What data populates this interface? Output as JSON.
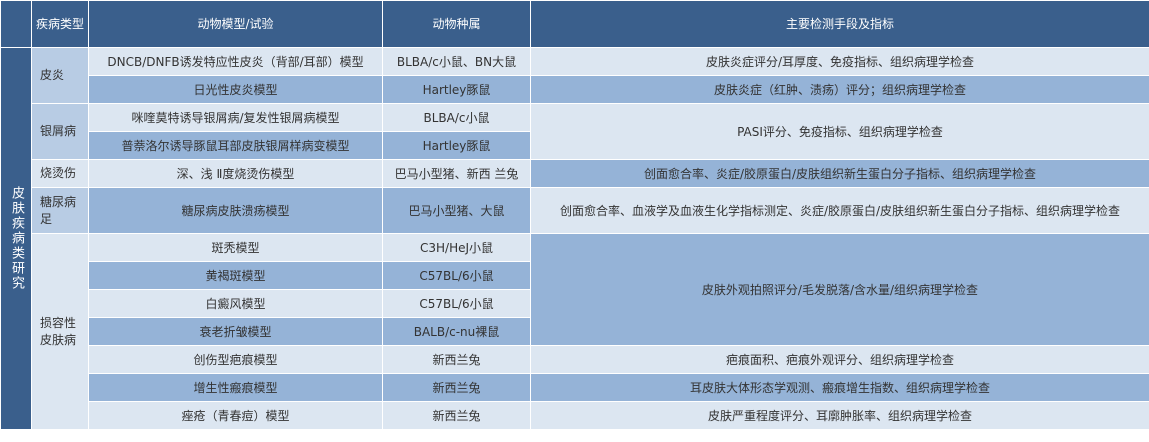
{
  "header": {
    "col_disease": "疾病类型",
    "col_model": "动物模型/试验",
    "col_species": "动物种属",
    "col_method": "主要检测手段及指标"
  },
  "side_label": "皮肤疾病类研究",
  "groups": {
    "dermatitis": "皮炎",
    "psoriasis": "银屑病",
    "burn": "烧烫伤",
    "diabetic_foot": "糖尿病足",
    "cosmetic": "损容性皮肤病"
  },
  "rows": [
    {
      "model": "DNCB/DNFB诱发特应性皮炎（背部/耳部）模型",
      "species": "BLBA/c小鼠、BN大鼠",
      "method": "皮肤炎症评分/耳厚度、免疫指标、组织病理学检查"
    },
    {
      "model": "日光性皮炎模型",
      "species": "Hartley豚鼠",
      "method": "皮肤炎症（红肿、渍疡）评分；组织病理学检查"
    },
    {
      "model": "咪喹莫特诱导银屑病/复发性银屑病模型",
      "species": "BLBA/c小鼠",
      "method": "PASI评分、免疫指标、组织病理学检查"
    },
    {
      "model": "普萘洛尔诱导豚鼠耳部皮肤银屑样病变模型",
      "species": "Hartley豚鼠",
      "method": ""
    },
    {
      "model": "深、浅 Ⅱ度烧烫伤模型",
      "species": "巴马小型猪、新西 兰兔",
      "method": "创面愈合率、炎症/胶原蛋白/皮肤组织新生蛋白分子指标、组织病理学检查"
    },
    {
      "model": "糖尿病皮肤溃疡模型",
      "species": "巴马小型猪、大鼠",
      "method": "创面愈合率、血液学及血液生化学指标测定、炎症/胶原蛋白/皮肤组织新生蛋白分子指标、组织病理学检查"
    },
    {
      "model": "斑秃模型",
      "species": "C3H/HeJ小鼠",
      "method": "皮肤外观拍照评分/毛发脱落/含水量/组织病理学检查"
    },
    {
      "model": "黄褐斑模型",
      "species": "C57BL/6小鼠",
      "method": ""
    },
    {
      "model": "白癜风模型",
      "species": "C57BL/6小鼠",
      "method": ""
    },
    {
      "model": "衰老折皱模型",
      "species": "BALB/c-nu裸鼠",
      "method": ""
    },
    {
      "model": "创伤型疤痕模型",
      "species": "新西兰兔",
      "method": "疤痕面积、疤痕外观评分、组织病理学检查"
    },
    {
      "model": "增生性瘢痕模型",
      "species": "新西兰兔",
      "method": "耳皮肤大体形态学观测、瘢痕增生指数、组织病理学检查"
    },
    {
      "model": "痤疮（青春痘）模型",
      "species": "新西兰兔",
      "method": "皮肤严重程度评分、耳廓肿胀率、组织病理学检查"
    }
  ]
}
